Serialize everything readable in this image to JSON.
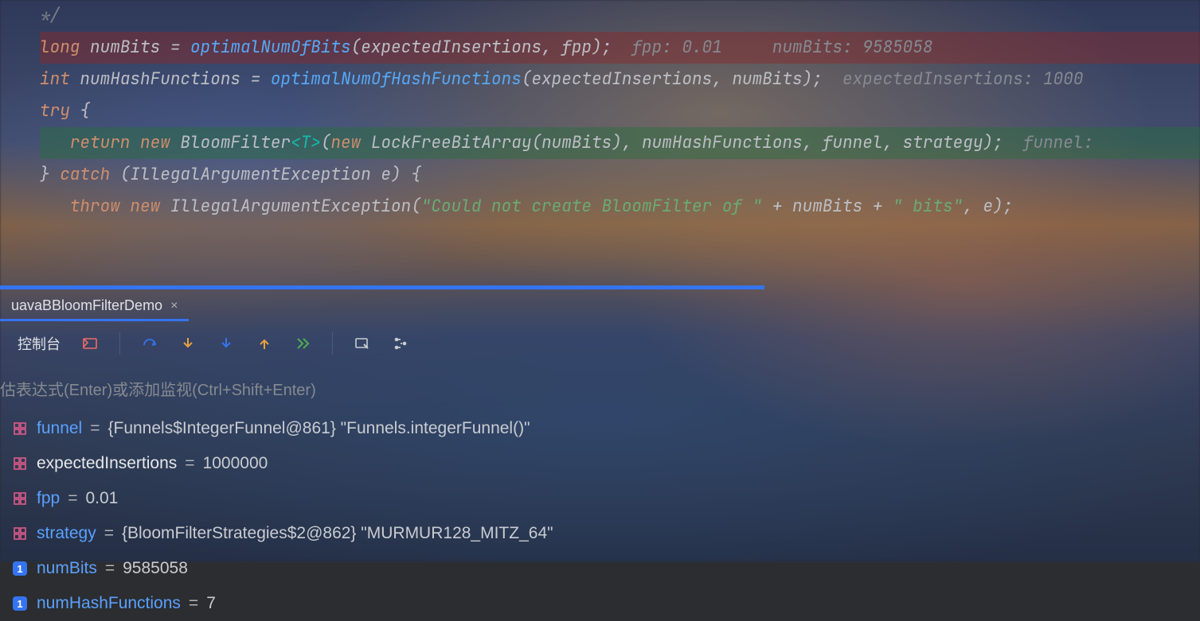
{
  "code": {
    "comment_close": "*/",
    "l1": {
      "kw": "long",
      "var": "numBits",
      "eq": " = ",
      "fn": "optimalNumOfBits",
      "args": "(expectedInsertions, fpp);",
      "hint": "  fpp: 0.01     numBits: 9585058"
    },
    "l2": {
      "kw": "int",
      "var": "numHashFunctions",
      "eq": " = ",
      "fn": "optimalNumOfHashFunctions",
      "args": "(expectedInsertions, numBits);",
      "hint": "  expectedInsertions: 1000"
    },
    "l3": {
      "kw": "try",
      "brace": " {"
    },
    "l4": {
      "indent": "   ",
      "kw1": "return",
      "kw2": " new ",
      "typ": "BloomFilter",
      "gen": "<T>",
      "paren1": "(",
      "kw3": "new ",
      "typ2": "LockFreeBitArray",
      "args2": "(numBits)",
      "rest": ", numHashFunctions, funnel, strategy);",
      "hint": "  funnel:"
    },
    "l5": {
      "close": "} ",
      "kw": "catch",
      "paren": " (IllegalArgumentException e) {"
    },
    "l6": {
      "indent": "   ",
      "kw1": "throw",
      "kw2": " new ",
      "typ": "IllegalArgumentException",
      "paren1": "(",
      "str": "\"Could not create BloomFilter of \"",
      "plus1": " + numBits + ",
      "str2": "\" bits\"",
      "rest": ", e);"
    }
  },
  "tab": {
    "label": "uavaBBloomFilterDemo",
    "close": "×"
  },
  "toolbar": {
    "console_label": "控制台"
  },
  "expr_hint": "估表达式(Enter)或添加监视(Ctrl+Shift+Enter)",
  "vars": [
    {
      "kind": "obj",
      "name": "funnel",
      "nameClass": "blue",
      "sep": " = ",
      "val": "{Funnels$IntegerFunnel@861} \"Funnels.integerFunnel()\""
    },
    {
      "kind": "obj",
      "name": "expectedInsertions",
      "nameClass": "white",
      "sep": " = ",
      "val": "1000000"
    },
    {
      "kind": "obj",
      "name": "fpp",
      "nameClass": "blue",
      "sep": " = ",
      "val": "0.01"
    },
    {
      "kind": "obj",
      "name": "strategy",
      "nameClass": "blue",
      "sep": " = ",
      "val": "{BloomFilterStrategies$2@862} \"MURMUR128_MITZ_64\""
    },
    {
      "kind": "prim",
      "name": "numBits",
      "nameClass": "blue",
      "sep": " = ",
      "val": "9585058"
    },
    {
      "kind": "prim",
      "name": "numHashFunctions",
      "nameClass": "blue",
      "sep": " = ",
      "val": "7"
    }
  ]
}
